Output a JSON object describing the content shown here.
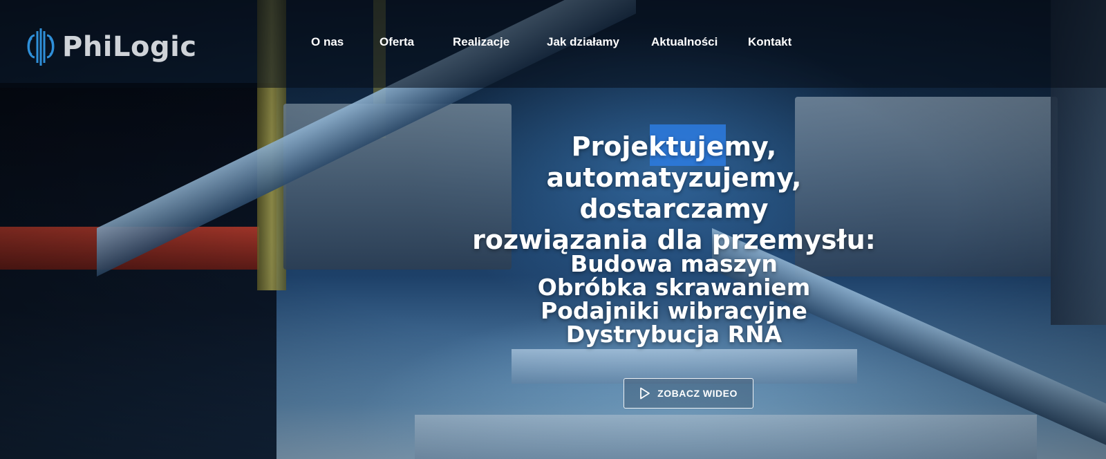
{
  "brand": {
    "name": "PhiLogic",
    "logo_icon": "phi-logo-icon",
    "logo_color": "#2f8fd8"
  },
  "nav": {
    "items": [
      {
        "label": "O nas"
      },
      {
        "label": "Oferta"
      },
      {
        "label": "Realizacje"
      },
      {
        "label": "Jak działamy"
      },
      {
        "label": "Aktualności"
      },
      {
        "label": "Kontakt"
      }
    ]
  },
  "hero": {
    "headline_lines": [
      "Projektujemy,",
      "automatyzujemy, dostarczamy",
      "rozwiązania dla przemysłu:"
    ],
    "services": [
      "Budowa maszyn",
      "Obróbka skrawaniem",
      "Podajniki wibracyjne",
      "Dystrybucja RNA"
    ],
    "video_button": {
      "label": "ZOBACZ WIDEO",
      "icon": "play-icon"
    }
  }
}
